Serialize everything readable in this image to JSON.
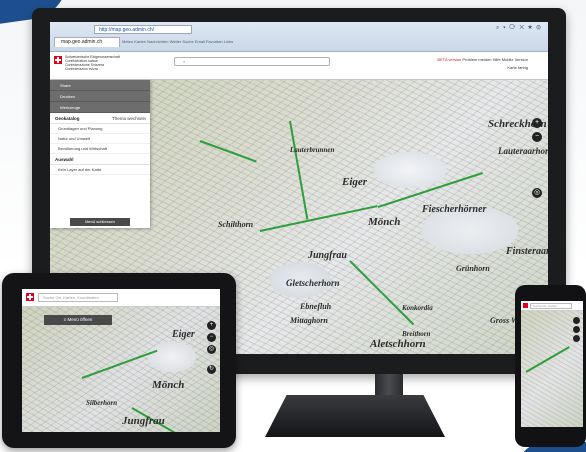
{
  "browser": {
    "url": "http://map.geo.admin.ch/",
    "tab_label": "map.geo.admin.ch",
    "bookmarks": "Meteo    Karten    Nachrichten    Wetter    Suche    Email    Favoriten    Links"
  },
  "app": {
    "confederation_lines": [
      "Schweizerische Eidgenossenschaft",
      "Confédération suisse",
      "Confederazione Svizzera",
      "Confederaziun svizra"
    ],
    "search_placeholder": "",
    "header_links": {
      "beta": "BETA version",
      "other": "Problem melden   Hilfe   Mobile Version"
    },
    "language_selector": "Karte farbig"
  },
  "side_menu": {
    "top_items": [
      "Share",
      "Drucken",
      "Werkzeuge"
    ],
    "themes_label": "Geokatalog",
    "themes_value": "Thema wechseln",
    "catalog_items": [
      "Grundlagen und Planung",
      "Natur und Umwelt",
      "Bevölkerung und Wirtschaft"
    ],
    "selection_label": "Auswahl",
    "selection_hint": "Kein Layer auf der Karte",
    "close_button": "Menü schliessen"
  },
  "map_labels": [
    {
      "text": "Schreckhorn"
    },
    {
      "text": "Lauteraarhorn"
    },
    {
      "text": "Eiger"
    },
    {
      "text": "Mönch"
    },
    {
      "text": "Fiescherhörner"
    },
    {
      "text": "Finsteraarhorn"
    },
    {
      "text": "Jungfrau"
    },
    {
      "text": "Gletscherhorn"
    },
    {
      "text": "Ebnefluh"
    },
    {
      "text": "Mittaghorn"
    },
    {
      "text": "Aletschhorn"
    },
    {
      "text": "Schilthorn"
    },
    {
      "text": "Grünhorn"
    },
    {
      "text": "Gross Wannenhorn"
    },
    {
      "text": "Konkordia"
    },
    {
      "text": "Lauterbrunnen"
    },
    {
      "text": "Breithorn"
    }
  ],
  "tablet": {
    "search_placeholder": "Suche Ort, Karten, Koordinaten",
    "menu_button": "Menü öffnen",
    "labels": [
      "Eiger",
      "Mönch",
      "Jungfrau",
      "Silberhorn"
    ]
  },
  "phone": {
    "search_placeholder": "Suche Ort, Karten"
  },
  "colors": {
    "route": "#2f9e3c",
    "swiss_red": "#e2001a",
    "menu_dark": "#4a4a4a"
  }
}
